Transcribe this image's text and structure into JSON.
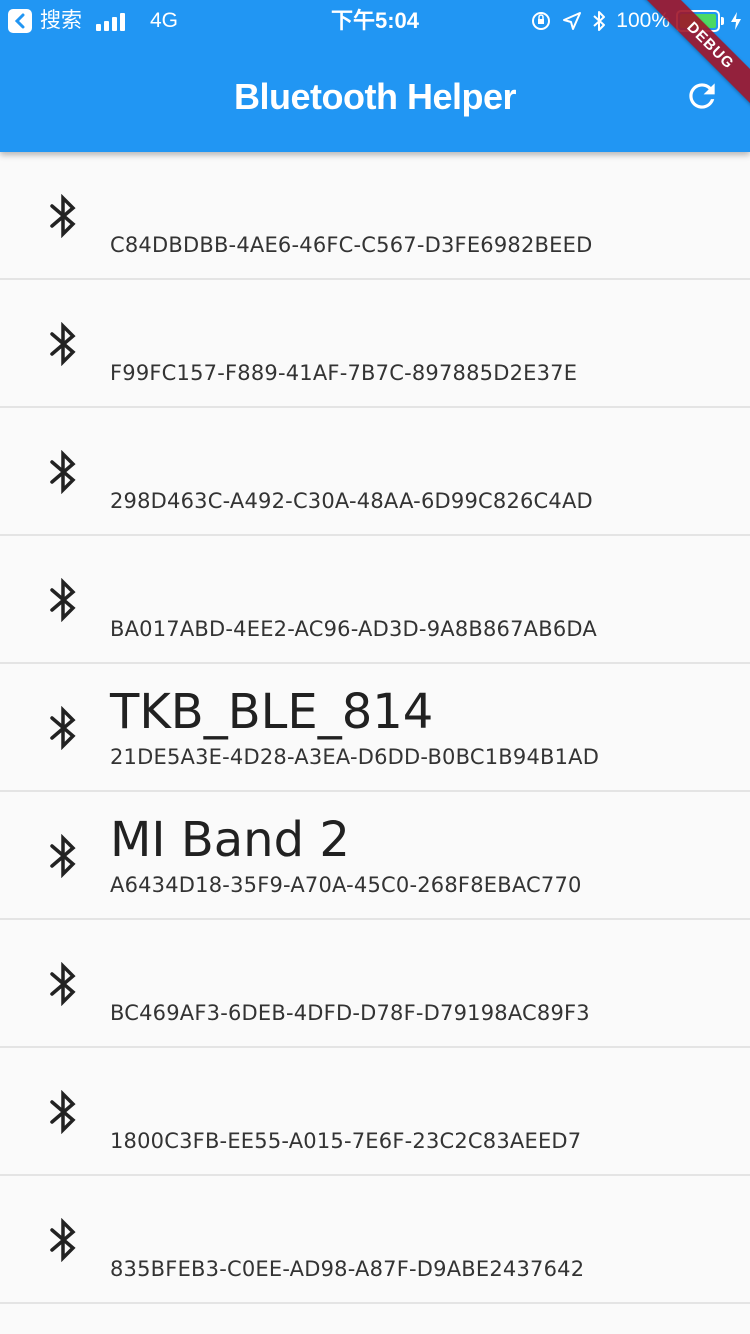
{
  "status_bar": {
    "back_label": "搜索",
    "network": "4G",
    "time": "下午5:04",
    "battery": "100%",
    "battery_level": 1.0
  },
  "app_bar": {
    "title": "Bluetooth Helper",
    "action_icon": "refresh-icon",
    "debug_banner": "DEBUG"
  },
  "colors": {
    "app_bar": "#2196f3",
    "background": "#fafafa",
    "battery": "#4cd964",
    "debug_banner": "#a01428"
  },
  "devices": [
    {
      "name": "",
      "id": "C84DBDBB-4AE6-46FC-C567-D3FE6982BEED"
    },
    {
      "name": "",
      "id": "F99FC157-F889-41AF-7B7C-897885D2E37E"
    },
    {
      "name": "",
      "id": "298D463C-A492-C30A-48AA-6D99C826C4AD"
    },
    {
      "name": "",
      "id": "BA017ABD-4EE2-AC96-AD3D-9A8B867AB6DA"
    },
    {
      "name": "TKB_BLE_814",
      "id": "21DE5A3E-4D28-A3EA-D6DD-B0BC1B94B1AD"
    },
    {
      "name": "MI Band 2",
      "id": "A6434D18-35F9-A70A-45C0-268F8EBAC770"
    },
    {
      "name": "",
      "id": "BC469AF3-6DEB-4DFD-D78F-D79198AC89F3"
    },
    {
      "name": "",
      "id": "1800C3FB-EE55-A015-7E6F-23C2C83AEED7"
    },
    {
      "name": "",
      "id": "835BFEB3-C0EE-AD98-A87F-D9ABE2437642"
    }
  ]
}
